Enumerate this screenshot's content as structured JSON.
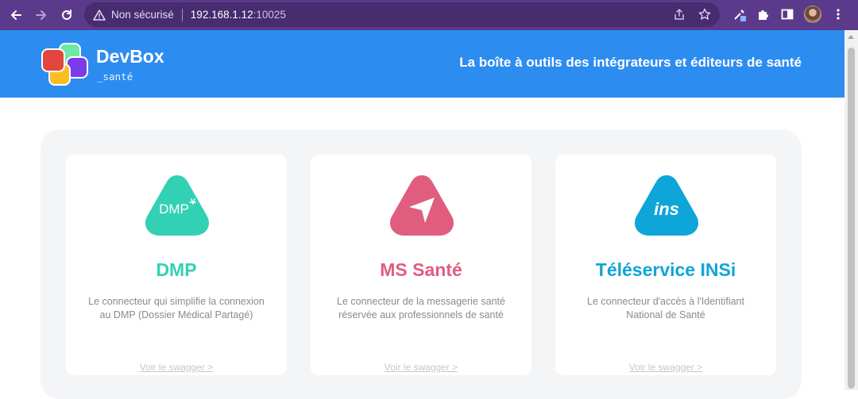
{
  "browser": {
    "security_label": "Non sécurisé",
    "host": "192.168.1.12",
    "port": ":10025"
  },
  "header": {
    "brand": "DevBox",
    "brand_sub": "_santé",
    "tagline": "La boîte à outils des intégrateurs et éditeurs de santé",
    "color": "#2d8cf0"
  },
  "cards": [
    {
      "title": "DMP",
      "badge_text": "DMP",
      "description": "Le connecteur qui simplifie la connexion au DMP (Dossier Médical Partagé)",
      "link": "Voir le swagger >",
      "color": "#33d1b4"
    },
    {
      "title": "MS Santé",
      "description": "Le connecteur de la messagerie santé réservée aux professionnels de santé",
      "link": "Voir le swagger >",
      "color": "#e05d80"
    },
    {
      "title": "Téléservice INSi",
      "badge_text": "ins",
      "description": "Le connecteur d'accès à l'Identifiant National de Santé",
      "link": "Voir le swagger >",
      "color": "#0ea5d8"
    }
  ]
}
